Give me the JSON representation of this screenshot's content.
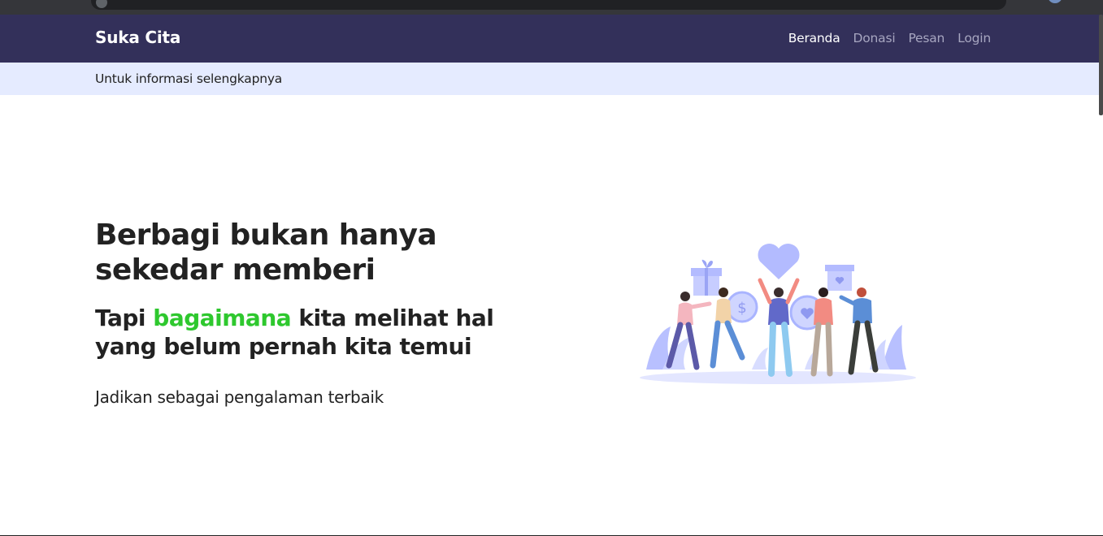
{
  "brand": {
    "name": "Suka Cita"
  },
  "nav": {
    "items": [
      {
        "label": "Beranda",
        "active": true
      },
      {
        "label": "Donasi",
        "active": false
      },
      {
        "label": "Pesan",
        "active": false
      },
      {
        "label": "Login",
        "active": false
      }
    ]
  },
  "info_bar": {
    "text": "Untuk informasi selengkapnya"
  },
  "hero": {
    "title_line1": "Berbagi bukan hanya",
    "title_line2": "sekedar memberi",
    "sub_prefix": "Tapi ",
    "sub_accent": "bagaimana",
    "sub_suffix": " kita melihat hal",
    "sub_line2": "yang belum pernah kita temui",
    "description": "Jadikan sebagai pengalaman terbaik"
  },
  "illustration": {
    "icon": "donation-people-illustration"
  },
  "colors": {
    "navbar": "#33305a",
    "info_bar": "#e5ebff",
    "accent_green": "#2ec82e",
    "illustration_purple": "#a9b4ff"
  }
}
